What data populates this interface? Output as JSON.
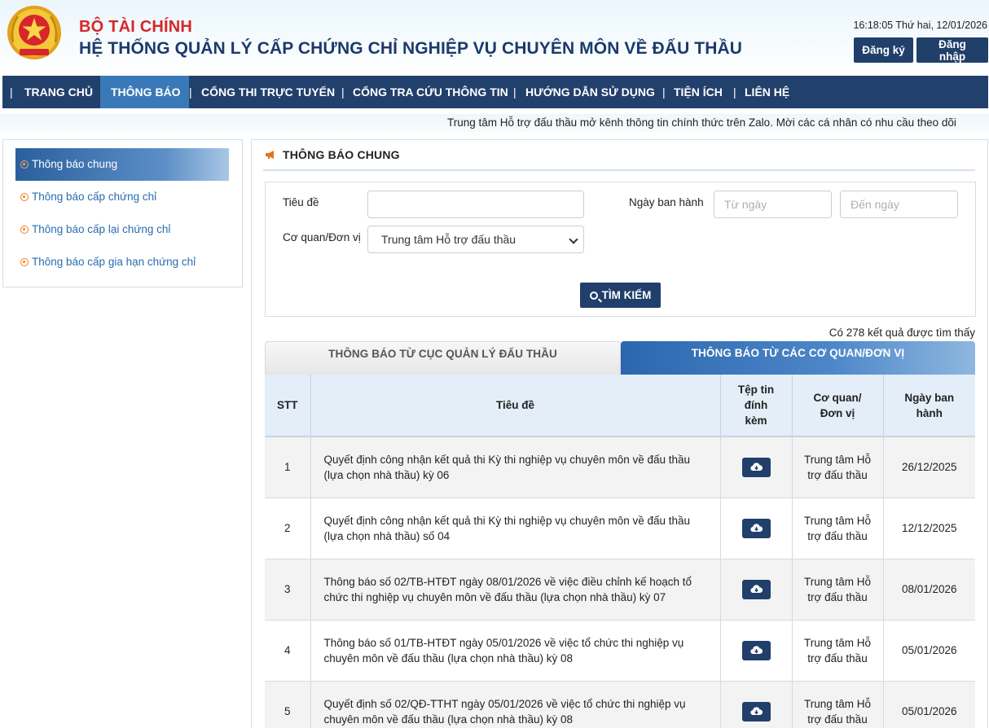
{
  "header": {
    "ministry": "BỘ TÀI CHÍNH",
    "system_title": "HỆ THỐNG QUẢN LÝ CẤP CHỨNG CHỈ NGHIỆP VỤ CHUYÊN MÔN VỀ ĐẤU THẦU",
    "datetime": "16:18:05 Thứ hai, 12/01/2026",
    "register_label": "Đăng ký",
    "login_label": "Đăng nhập",
    "colors": {
      "ministry": "#d7262b",
      "title": "#1c3a6b",
      "nav": "#22406c",
      "nav_active": "#3a79b7",
      "button": "#213f6b"
    }
  },
  "nav": {
    "separator": "|",
    "items": [
      {
        "label": "TRANG CHỦ"
      },
      {
        "label": "THÔNG BÁO",
        "active": true
      },
      {
        "label": "CỔNG THI TRỰC TUYẾN"
      },
      {
        "label": "CỔNG TRA CỨU THÔNG TIN"
      },
      {
        "label": "HƯỚNG DẪN SỬ DỤNG"
      },
      {
        "label": "TIỆN ÍCH"
      },
      {
        "label": "LIÊN HỆ"
      }
    ]
  },
  "marquee": {
    "text": "Trung tâm Hỗ trợ đấu thầu mở kênh thông tin chính thức trên Zalo. Mời các cá nhân có nhu cầu theo dõi"
  },
  "sidebar": {
    "items": [
      {
        "label": "Thông báo chung",
        "active": true
      },
      {
        "label": "Thông báo cấp chứng chỉ"
      },
      {
        "label": "Thông báo cấp lại chứng chỉ"
      },
      {
        "label": "Thông báo cấp gia hạn chứng chỉ"
      }
    ]
  },
  "main": {
    "title": "THÔNG BÁO CHUNG",
    "filters": {
      "title_label": "Tiêu đề",
      "title_value": "",
      "date_label": "Ngày ban hành",
      "from_placeholder": "Từ ngày",
      "to_placeholder": "Đến ngày",
      "agency_label": "Cơ quan/Đơn vị",
      "agency_selected": "Trung tâm Hỗ trợ đấu thầu",
      "search_label": "TÌM KIẾM"
    },
    "result_count": "Có 278 kết quả được tìm thấy",
    "tabs": [
      {
        "label": "THÔNG BÁO TỪ CỤC QUẢN LÝ ĐẤU THẦU"
      },
      {
        "label": "THÔNG BÁO TỪ CÁC CƠ QUAN/ĐƠN VỊ",
        "active": true
      }
    ],
    "table": {
      "headers": [
        "STT",
        "Tiêu đề",
        "Tệp tin đính kèm",
        "Cơ quan/ Đơn vị",
        "Ngày ban hành"
      ],
      "rows": [
        {
          "stt": "1",
          "title": "Quyết định công nhận kết quả thi Kỳ thi nghiệp vụ chuyên môn về đấu thầu (lựa chọn nhà thầu) kỳ 06",
          "agency": "Trung tâm Hỗ trợ đấu thầu",
          "date": "26/12/2025"
        },
        {
          "stt": "2",
          "title": "Quyết định công nhận kết quả thi Kỳ thi nghiệp vụ chuyên môn về đấu thầu (lựa chọn nhà thầu) số 04",
          "agency": "Trung tâm Hỗ trợ đấu thầu",
          "date": "12/12/2025"
        },
        {
          "stt": "3",
          "title": "Thông báo số 02/TB-HTĐT ngày 08/01/2026 về việc điều chỉnh kế hoạch tổ chức thi nghiệp vụ chuyên môn về đấu thầu (lựa chọn nhà thầu) kỳ 07",
          "agency": "Trung tâm Hỗ trợ đấu thầu",
          "date": "08/01/2026"
        },
        {
          "stt": "4",
          "title": "Thông báo số 01/TB-HTĐT ngày 05/01/2026 về việc tổ chức thi nghiệp vụ chuyên môn về đấu thầu (lựa chọn nhà thầu) kỳ 08",
          "agency": "Trung tâm Hỗ trợ đấu thầu",
          "date": "05/01/2026"
        },
        {
          "stt": "5",
          "title": "Quyết định số 02/QĐ-TTHT ngày 05/01/2026 về việc tổ chức thi nghiệp vụ chuyên môn về đấu thầu (lựa chọn nhà thầu) kỳ 08",
          "agency": "Trung tâm Hỗ trợ đấu thầu",
          "date": "05/01/2026"
        }
      ],
      "download_icon": "cloud-download-icon"
    }
  }
}
